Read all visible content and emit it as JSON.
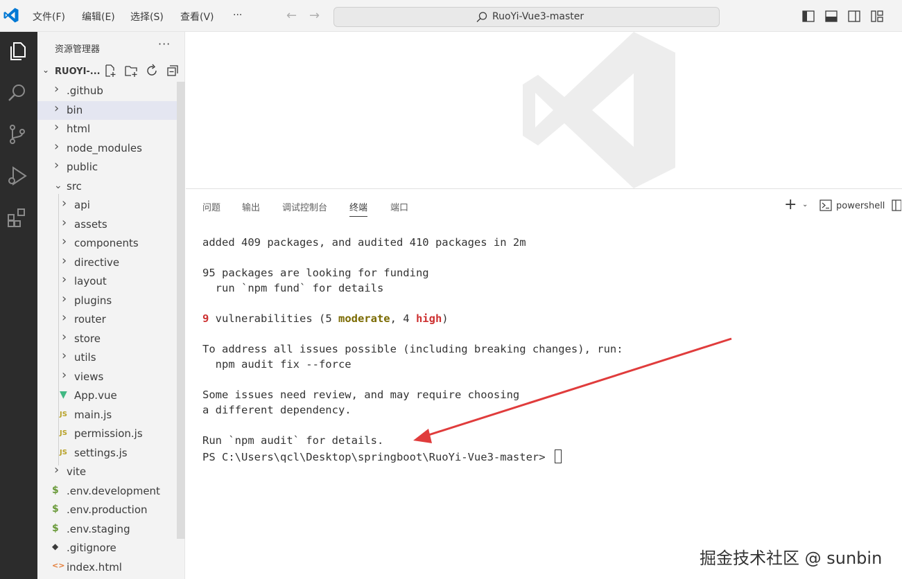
{
  "titlebar": {
    "menus": [
      "文件(F)",
      "编辑(E)",
      "选择(S)",
      "查看(V)",
      "···"
    ],
    "search_text": "RuoYi-Vue3-master"
  },
  "activity_icons": [
    "explorer-icon",
    "search-icon",
    "source-control-icon",
    "run-debug-icon",
    "extensions-icon"
  ],
  "sidebar": {
    "title": "资源管理器",
    "more": "···",
    "project": "RUOYI-...",
    "tree": [
      {
        "label": ".github",
        "type": "folder",
        "depth": 0
      },
      {
        "label": "bin",
        "type": "folder",
        "depth": 0,
        "highlighted": true
      },
      {
        "label": "html",
        "type": "folder",
        "depth": 0
      },
      {
        "label": "node_modules",
        "type": "folder",
        "depth": 0
      },
      {
        "label": "public",
        "type": "folder",
        "depth": 0
      },
      {
        "label": "src",
        "type": "folder-open",
        "depth": 0
      },
      {
        "label": "api",
        "type": "folder",
        "depth": 1
      },
      {
        "label": "assets",
        "type": "folder",
        "depth": 1
      },
      {
        "label": "components",
        "type": "folder",
        "depth": 1
      },
      {
        "label": "directive",
        "type": "folder",
        "depth": 1
      },
      {
        "label": "layout",
        "type": "folder",
        "depth": 1
      },
      {
        "label": "plugins",
        "type": "folder",
        "depth": 1
      },
      {
        "label": "router",
        "type": "folder",
        "depth": 1
      },
      {
        "label": "store",
        "type": "folder",
        "depth": 1
      },
      {
        "label": "utils",
        "type": "folder",
        "depth": 1
      },
      {
        "label": "views",
        "type": "folder",
        "depth": 1
      },
      {
        "label": "App.vue",
        "type": "vue",
        "depth": 1
      },
      {
        "label": "main.js",
        "type": "js",
        "depth": 1
      },
      {
        "label": "permission.js",
        "type": "js",
        "depth": 1
      },
      {
        "label": "settings.js",
        "type": "js",
        "depth": 1
      },
      {
        "label": "vite",
        "type": "folder",
        "depth": 0
      },
      {
        "label": ".env.development",
        "type": "env",
        "depth": 0
      },
      {
        "label": ".env.production",
        "type": "env",
        "depth": 0
      },
      {
        "label": ".env.staging",
        "type": "env",
        "depth": 0
      },
      {
        "label": ".gitignore",
        "type": "git",
        "depth": 0
      },
      {
        "label": "index.html",
        "type": "html",
        "depth": 0
      }
    ]
  },
  "panel": {
    "tabs": [
      "问题",
      "输出",
      "调试控制台",
      "终端",
      "端口"
    ],
    "active_tab": "终端",
    "shell": "powershell"
  },
  "terminal": {
    "line1": "added 409 packages, and audited 410 packages in 2m",
    "line2": "95 packages are looking for funding",
    "line3": "  run `npm fund` for details",
    "vuln_count": "9",
    "vuln_text1": " vulnerabilities (5 ",
    "vuln_moderate": "moderate",
    "vuln_text2": ", 4 ",
    "vuln_high": "high",
    "vuln_text3": ")",
    "line5": "To address all issues possible (including breaking changes), run:",
    "line6": "  npm audit fix --force",
    "line7": "Some issues need review, and may require choosing",
    "line8": "a different dependency.",
    "line9": "Run `npm audit` for details.",
    "prompt": "PS C:\\Users\\qcl\\Desktop\\springboot\\RuoYi-Vue3-master> "
  },
  "watermark_text": "掘金技术社区 @ sunbin",
  "colors": {
    "activity_bar": "#2c2c2c",
    "sidebar": "#f3f3f3",
    "vscode_blue": "#0078d4",
    "vue_green": "#41b883",
    "js_yellow": "#b8a229",
    "arrow_red": "#e03c3c"
  }
}
